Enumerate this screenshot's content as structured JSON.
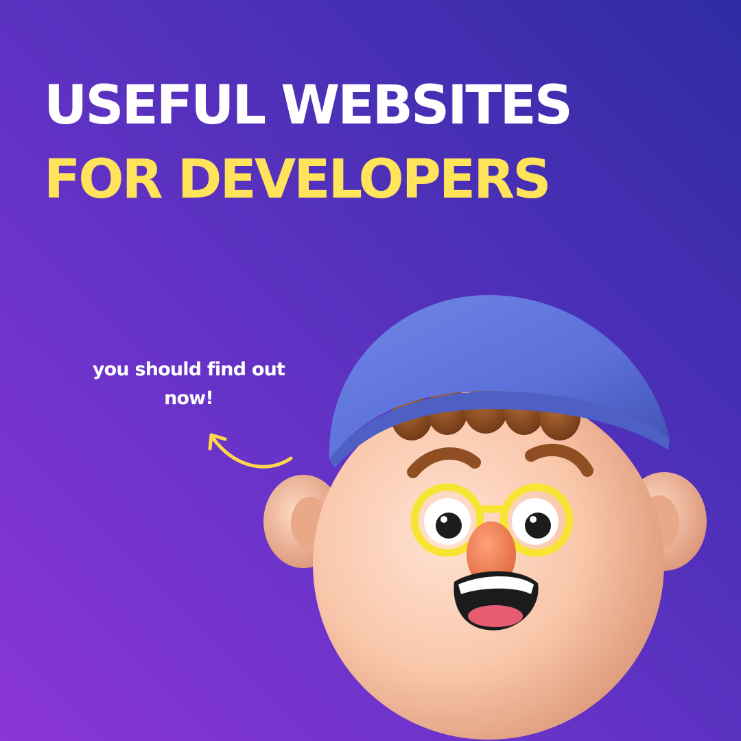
{
  "headline": {
    "line1": "USEFUL WEBSITES",
    "line2": "FOR DEVELOPERS"
  },
  "note": {
    "text": "you should find out now!"
  },
  "icons": {
    "arrow": "curved-arrow-icon",
    "character": "cartoon-boy-with-cap-and-glasses"
  },
  "colors": {
    "background_start": "#8a35d6",
    "background_end": "#2f2ba3",
    "headline_white": "#ffffff",
    "headline_yellow": "#ffe35a",
    "arrow": "#ffd84a",
    "cap": "#5b6fd8",
    "skin": "#f8c4a8",
    "glasses": "#f7e433",
    "nose": "#ee8054",
    "hair": "#8f4f23"
  }
}
